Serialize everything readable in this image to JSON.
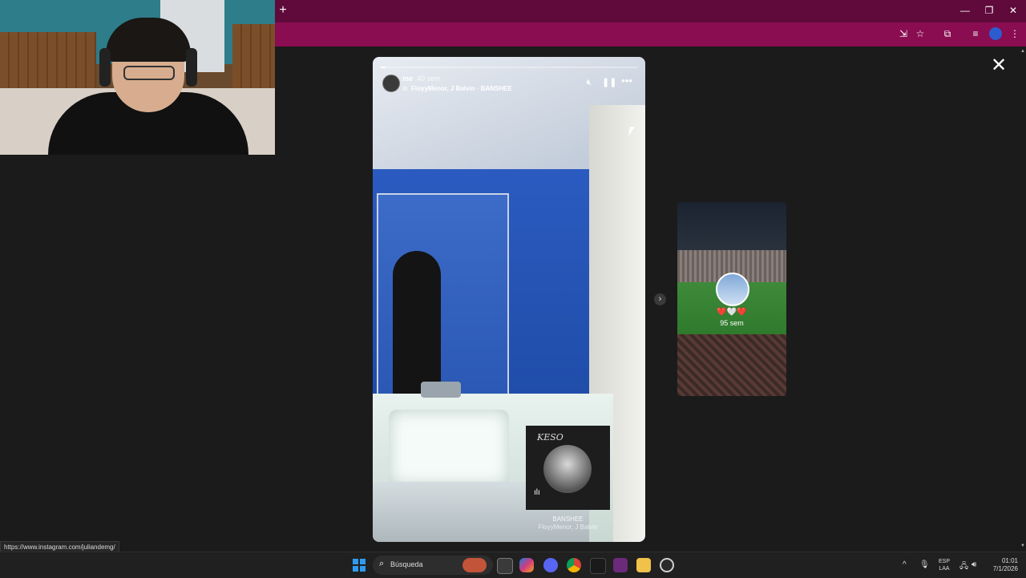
{
  "browser": {
    "new_tab_symbol": "+",
    "minimize": "—",
    "restore": "❐",
    "close": "✕"
  },
  "story": {
    "username": "me",
    "time_ago": "40 sem",
    "song": "FloyyMenor, J Balvin · BANSHEE",
    "progress": 0.02,
    "sticker_track": "BANSHEE",
    "sticker_artist": "FloyyMenor, J Balvin",
    "sticker_title": "KESO",
    "sticker_bars": "ılı"
  },
  "preview": {
    "hearts": "❤️🤍❤️",
    "time_ago": "95 sem"
  },
  "status_bar": {
    "url": "https://www.instagram.com/juliandemg/"
  },
  "taskbar": {
    "search_placeholder": "Búsqueda",
    "lang_line1": "ESP",
    "lang_line2": "LAA",
    "time": "01:01",
    "date": "7/1/2026"
  },
  "icons": {
    "close_story": "close-icon",
    "next": "chevron-right-icon",
    "mute": "speaker-muted-icon",
    "pause": "pause-icon",
    "more": "more-icon"
  }
}
